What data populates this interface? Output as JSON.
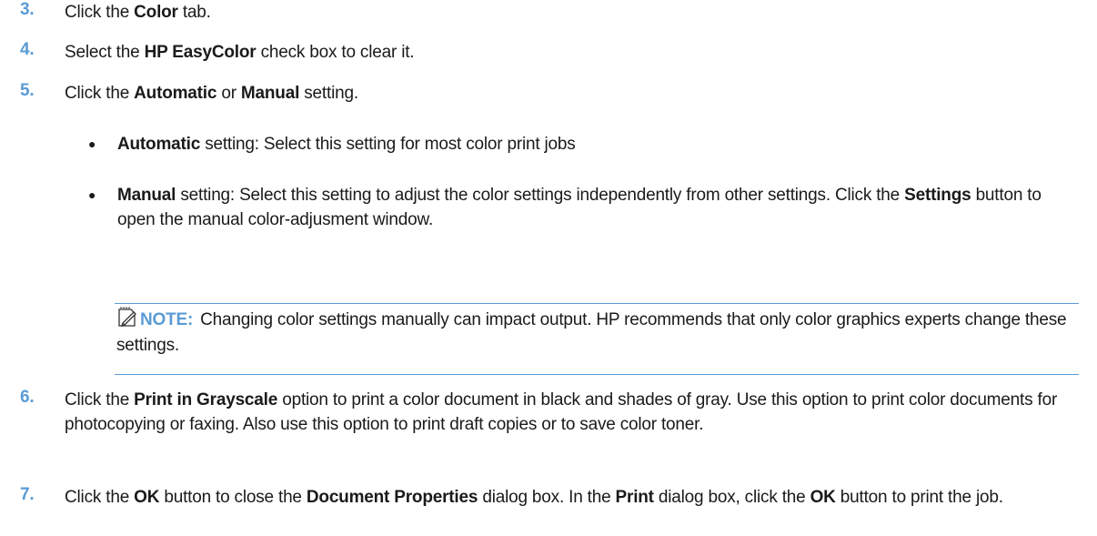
{
  "steps": [
    {
      "num": "3.",
      "segments": [
        {
          "t": "Click the ",
          "b": false
        },
        {
          "t": "Color",
          "b": true
        },
        {
          "t": " tab.",
          "b": false
        }
      ]
    },
    {
      "num": "4.",
      "segments": [
        {
          "t": "Select the ",
          "b": false
        },
        {
          "t": "HP EasyColor",
          "b": true
        },
        {
          "t": " check box to clear it.",
          "b": false
        }
      ]
    },
    {
      "num": "5.",
      "segments": [
        {
          "t": "Click the ",
          "b": false
        },
        {
          "t": "Automatic",
          "b": true
        },
        {
          "t": " or ",
          "b": false
        },
        {
          "t": "Manual",
          "b": true
        },
        {
          "t": " setting.",
          "b": false
        }
      ]
    },
    {
      "num": "6.",
      "segments": [
        {
          "t": "Click the ",
          "b": false
        },
        {
          "t": "Print in Grayscale",
          "b": true
        },
        {
          "t": " option to print a color document in black and shades of gray. Use this option to print color documents for photocopying or faxing. Also use this option to print draft copies or to save color toner.",
          "b": false
        }
      ]
    },
    {
      "num": "7.",
      "segments": [
        {
          "t": "Click the ",
          "b": false
        },
        {
          "t": "OK",
          "b": true
        },
        {
          "t": " button to close the ",
          "b": false
        },
        {
          "t": "Document Properties",
          "b": true
        },
        {
          "t": " dialog box. In the ",
          "b": false
        },
        {
          "t": "Print",
          "b": true
        },
        {
          "t": " dialog box, click the ",
          "b": false
        },
        {
          "t": "OK",
          "b": true
        },
        {
          "t": " button to print the job.",
          "b": false
        }
      ]
    }
  ],
  "bullets": [
    {
      "dot": "●",
      "segments": [
        {
          "t": "Automatic",
          "b": true
        },
        {
          "t": " setting: Select this setting for most color print jobs",
          "b": false
        }
      ]
    },
    {
      "dot": "●",
      "segments": [
        {
          "t": "Manual",
          "b": true
        },
        {
          "t": " setting: Select this setting to adjust the color settings independently from other settings. Click the ",
          "b": false
        },
        {
          "t": "Settings",
          "b": true
        },
        {
          "t": " button to open the manual color-adjusment window.",
          "b": false
        }
      ]
    }
  ],
  "note": {
    "label": "NOTE:",
    "text": "Changing color settings manually can impact output. HP recommends that only color graphics experts change these settings.",
    "icon": "note-pencil-icon"
  },
  "colors": {
    "accent": "#5b9bd5",
    "text": "#1a1a1a"
  }
}
